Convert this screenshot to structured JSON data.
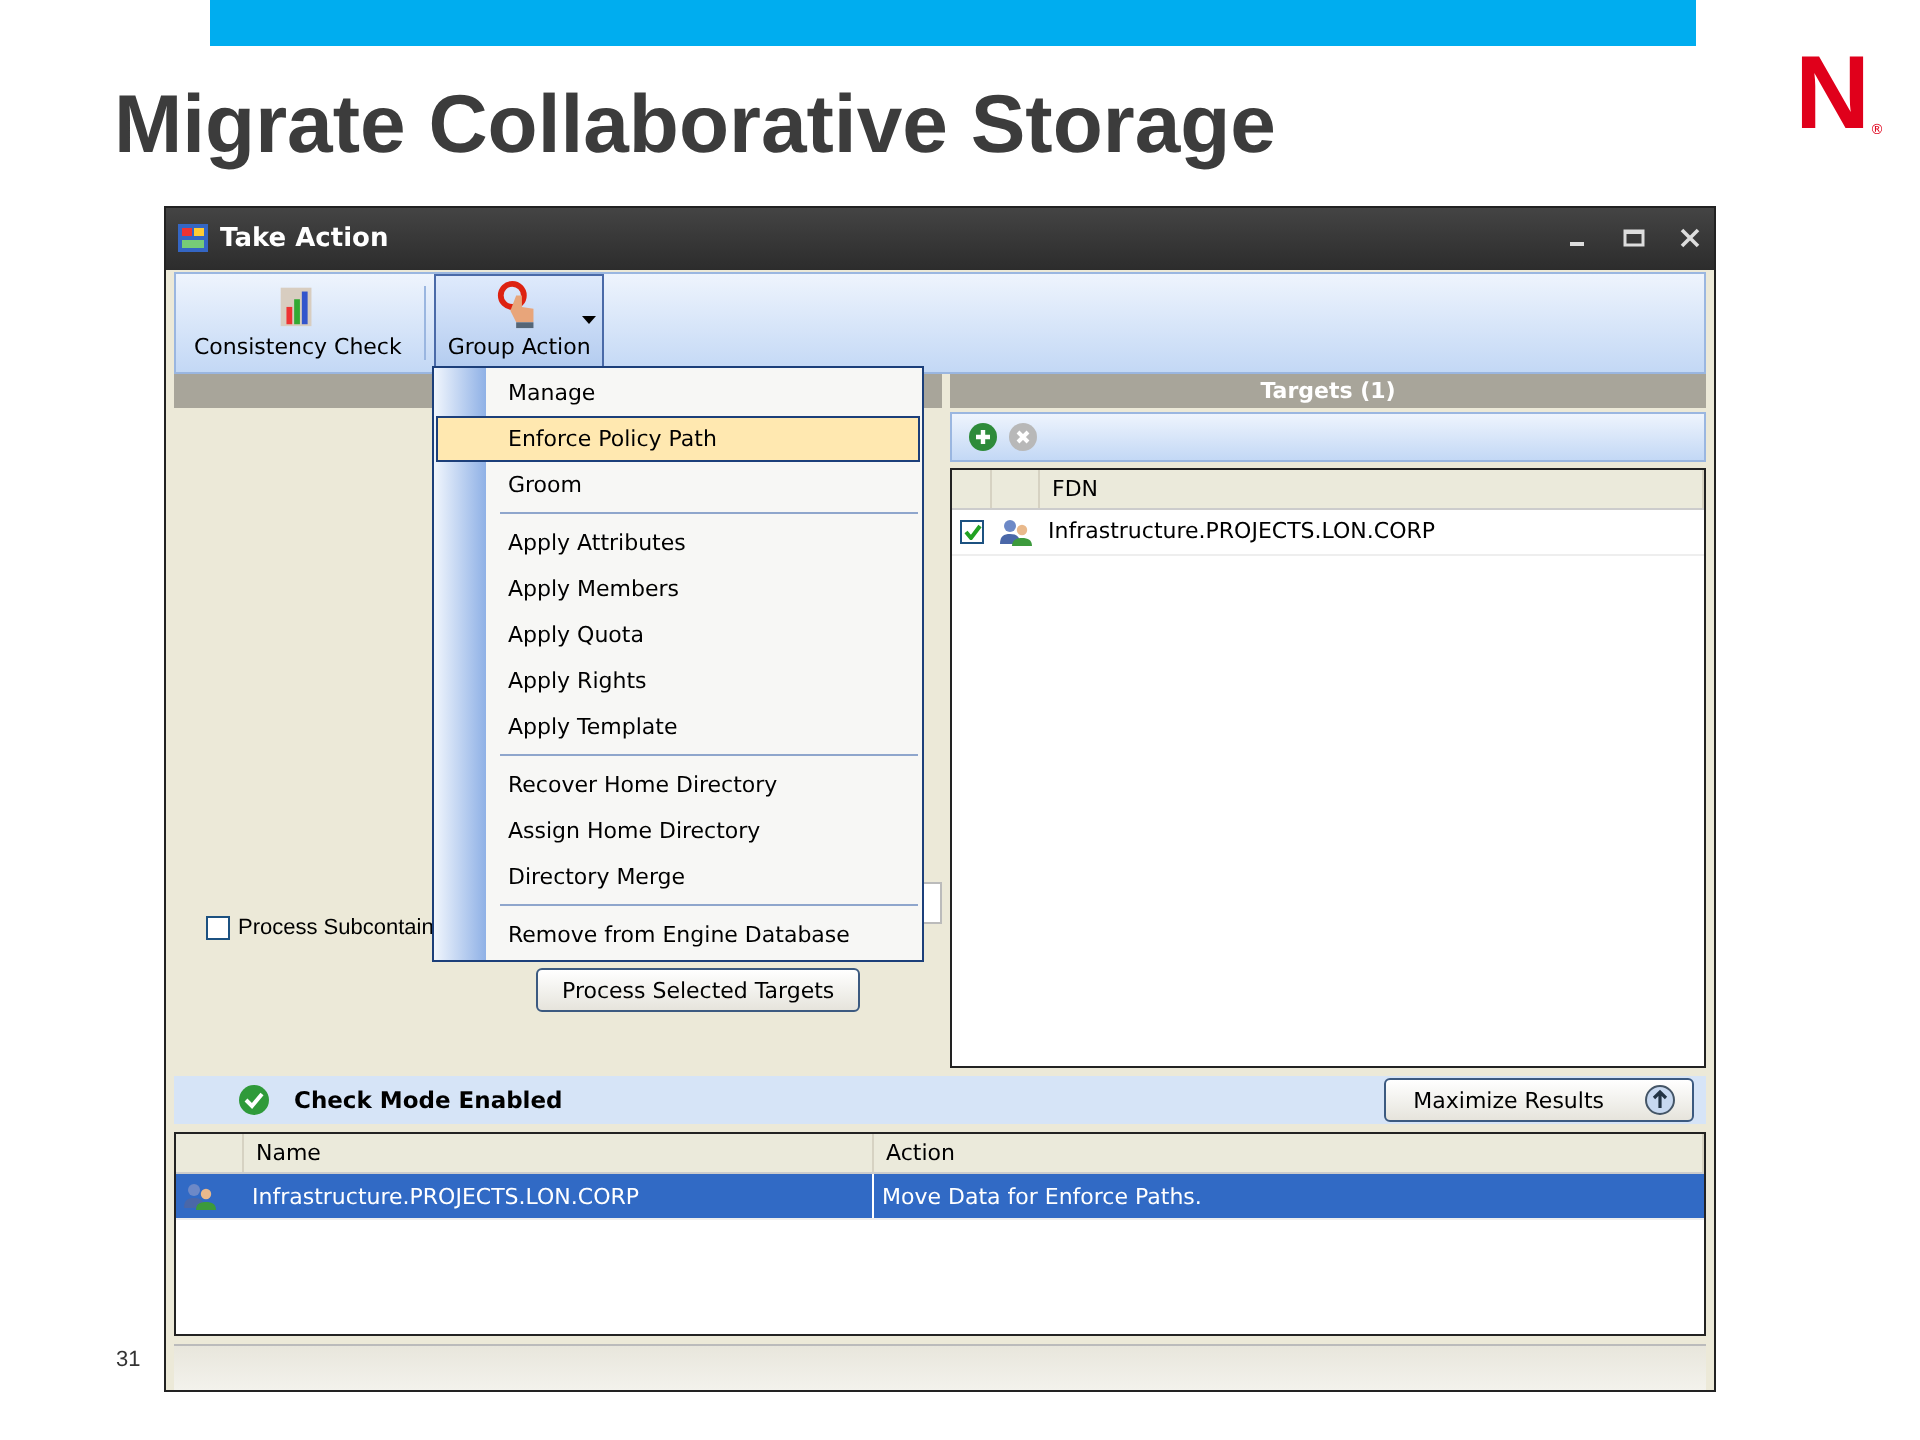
{
  "slide": {
    "title": "Migrate Collaborative Storage",
    "logo": "N",
    "logo_mark": "®",
    "page_number": "31"
  },
  "window": {
    "title": "Take Action"
  },
  "toolbar": [
    {
      "label": "Consistency Check",
      "kind": "button",
      "selected": false
    },
    {
      "label": "Group Action",
      "kind": "dropdown",
      "selected": true
    }
  ],
  "menu": {
    "groups": [
      [
        {
          "label": "Manage",
          "selected": false
        },
        {
          "label": "Enforce Policy Path",
          "selected": true
        },
        {
          "label": "Groom",
          "selected": false
        }
      ],
      [
        {
          "label": "Apply Attributes",
          "selected": false
        },
        {
          "label": "Apply Members",
          "selected": false
        },
        {
          "label": "Apply Quota",
          "selected": false
        },
        {
          "label": "Apply Rights",
          "selected": false
        },
        {
          "label": "Apply Template",
          "selected": false
        }
      ],
      [
        {
          "label": "Recover Home Directory",
          "selected": false
        },
        {
          "label": "Assign Home Directory",
          "selected": false
        },
        {
          "label": "Directory Merge",
          "selected": false
        }
      ],
      [
        {
          "label": "Remove from Engine Database",
          "selected": false
        }
      ]
    ]
  },
  "left_panel": {
    "checkbox": {
      "label": "Process Subcontain",
      "checked": false
    },
    "button": "Process Selected Targets"
  },
  "targets": {
    "title": "Targets (1)",
    "columns": [
      "FDN"
    ],
    "rows": [
      {
        "fdn": "Infrastructure.PROJECTS.LON.CORP",
        "checked": true
      }
    ]
  },
  "status": {
    "text": "Check Mode Enabled",
    "button": "Maximize Results"
  },
  "results": {
    "columns": [
      "Name",
      "Action"
    ],
    "rows": [
      {
        "name": "Infrastructure.PROJECTS.LON.CORP",
        "action": "Move Data for Enforce Paths.",
        "selected": true
      }
    ]
  }
}
